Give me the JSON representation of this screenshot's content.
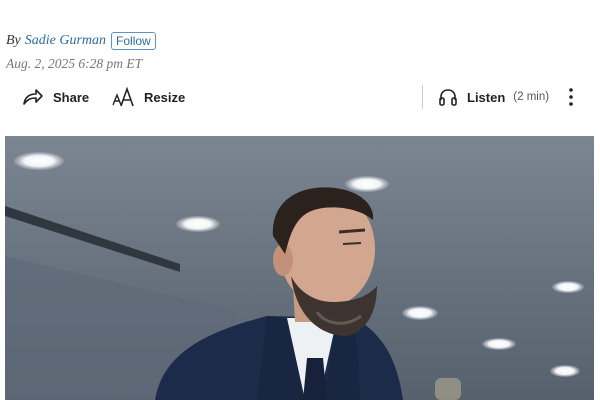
{
  "byline": {
    "prefix": "By",
    "author": "Sadie Gurman",
    "follow_label": "Follow"
  },
  "timestamp": "Aug. 2, 2025 6:28 pm ET",
  "toolbar": {
    "share_label": "Share",
    "resize_label": "Resize",
    "listen_label": "Listen",
    "listen_duration": "(2 min)"
  },
  "icons": {
    "share": "share-arrow-icon",
    "resize": "text-resize-icon",
    "listen": "headphones-icon",
    "more": "vertical-ellipsis-icon"
  },
  "colors": {
    "link": "#2a6ea3",
    "timestamp": "#777777"
  }
}
